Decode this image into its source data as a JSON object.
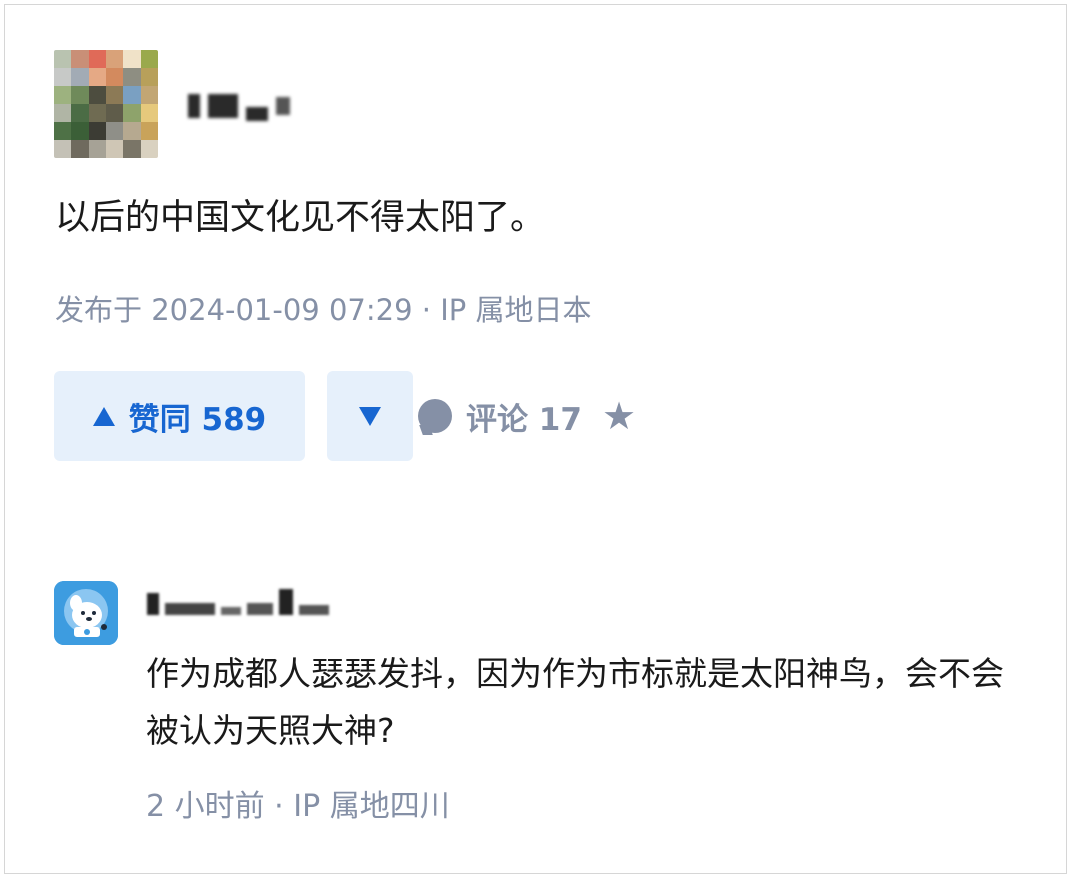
{
  "post": {
    "author_avatar_colors": [
      "#b9c3b0",
      "#c98f77",
      "#e06a58",
      "#d9a279",
      "#f0e2c8",
      "#9aa94c",
      "#c7c9c7",
      "#a2abb5",
      "#e5a985",
      "#d38a5e",
      "#8e8e82",
      "#b8a05a",
      "#9db27f",
      "#6f8a5a",
      "#4d4d3f",
      "#8c7a56",
      "#7aa0c2",
      "#c2a674",
      "#b0b5a5",
      "#4b6c45",
      "#6f6b52",
      "#5f5c4a",
      "#8ea36b",
      "#e6c97c",
      "#4e7146",
      "#3b5f37",
      "#3c3c34",
      "#8f8f88",
      "#b6a990",
      "#c9a35a",
      "#c4c1b6",
      "#6f6a5e",
      "#a6a296",
      "#cfc6b5",
      "#7a7567",
      "#d9d1c0"
    ],
    "text": "以后的中国文化见不得太阳了。",
    "meta": "发布于 2024-01-09 07:29 · IP 属地日本"
  },
  "actions": {
    "upvote_label": "赞同 589",
    "comment_label": "评论 17"
  },
  "comment": {
    "text": "作为成都人瑟瑟发抖，因为作为市标就是太阳神鸟，会不会被认为天照大神?",
    "meta": "2 小时前 · IP 属地四川"
  },
  "colors": {
    "accent": "#1766d1",
    "button_bg": "#e6f0fb",
    "meta_gray": "#8590a6",
    "avatar_blue": "#3d9ce0"
  }
}
